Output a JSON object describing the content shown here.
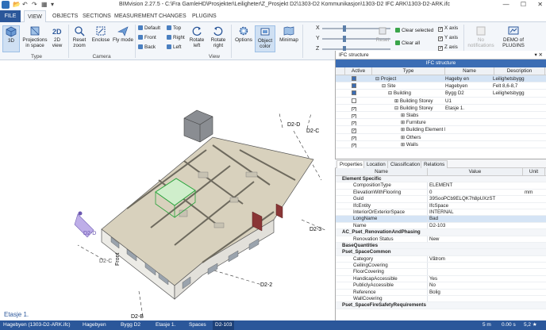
{
  "titlebar": {
    "title": "BIMvision 2.27.5 - C:\\Fra GamleHD\\Prosjekter\\Leiligheter\\Z_Prosjekt D2\\1303-D2 Kommunikasjon\\1303-D2 IFC ARK\\1303-D2-ARK.ifc",
    "minimize": "—",
    "maximize": "☐",
    "close": "✕"
  },
  "tabs": [
    "FILE",
    "VIEW",
    "OBJECTS",
    "SECTIONS",
    "MEASUREMENT",
    "CHANGES",
    "PLUGINS"
  ],
  "ribbon": {
    "type_group": "Type",
    "camera_group": "Camera",
    "view_group": "View",
    "btn_3d": "3D",
    "btn_projections": "Projections in space",
    "btn_2d": "2D view",
    "btn_reset_zoom": "Reset zoom",
    "btn_enclose": "Enclose",
    "btn_fly": "Fly mode",
    "views": [
      "Default",
      "Front",
      "Back",
      "Top",
      "Right",
      "Left"
    ],
    "btn_rotate_left": "Rotate left",
    "btn_rotate_right": "Rotate right",
    "btn_options": "Options",
    "btn_object_color": "Object color",
    "btn_minimap": "Minimap",
    "slider_x": "X",
    "slider_y": "Y",
    "slider_z": "Z",
    "btn_reset": "Reset",
    "btn_clear_selected": "Clear selected",
    "btn_clear_all": "Clear all",
    "cb_x_axis": "X axis",
    "cb_y_axis": "Y axis",
    "cb_z_axis": "Z axis",
    "btn_notifications": "No notifications",
    "btn_demo": "DEMO of PLUGINS"
  },
  "viewport": {
    "labels": [
      "D2-D",
      "D2-C",
      "D2-3",
      "D2-2",
      "D2-B",
      "D2-C",
      "Front",
      "D2-D"
    ],
    "storey_label": "Etasje 1."
  },
  "ifc": {
    "panel_title": "IFC structure",
    "sub_title": "IFC structure",
    "columns": [
      "Active",
      "Type",
      "Name",
      "Description"
    ],
    "rows": [
      {
        "type": "Project",
        "name": "Hageby en",
        "desc": "Leilighetsbygg"
      },
      {
        "type": "Site",
        "name": "Hagebyen",
        "desc": "Felt 8,6-8,7"
      },
      {
        "type": "Building",
        "name": "Bygg D2",
        "desc": "Leilighetsbygg"
      },
      {
        "type": "Building Storey",
        "name": "U1",
        "desc": ""
      },
      {
        "type": "Building Storey",
        "name": "Etasje 1.",
        "desc": ""
      },
      {
        "type": "Slabs",
        "name": "",
        "desc": ""
      },
      {
        "type": "Furniture",
        "name": "",
        "desc": ""
      },
      {
        "type": "Building Element Proxies",
        "name": "",
        "desc": ""
      },
      {
        "type": "Others",
        "name": "",
        "desc": ""
      },
      {
        "type": "Walls",
        "name": "",
        "desc": ""
      }
    ]
  },
  "prop_tabs": [
    "Properties",
    "Location",
    "Classification",
    "Relations"
  ],
  "props": {
    "columns": [
      "Name",
      "Value",
      "Unit"
    ],
    "rows": [
      {
        "g": true,
        "n": "Element Specific"
      },
      {
        "n": "CompositionType",
        "v": "ELEMENT"
      },
      {
        "n": "ElevationWithFlooring",
        "v": "0",
        "u": "mm"
      },
      {
        "n": "Guid",
        "v": "39SooPCb9ELQK7h8pUXzST"
      },
      {
        "n": "IfcEntity",
        "v": "IfcSpace"
      },
      {
        "n": "InteriorOrExteriorSpace",
        "v": "INTERNAL"
      },
      {
        "n": "LongName",
        "v": "Bad",
        "s": true
      },
      {
        "n": "Name",
        "v": "D2-103"
      },
      {
        "g": true,
        "n": "AC_Pset_RenovationAndPhasing"
      },
      {
        "n": "Renovation Status",
        "v": "New"
      },
      {
        "g": true,
        "n": "BaseQuantities"
      },
      {
        "g": true,
        "n": "Pset_SpaceCommon"
      },
      {
        "n": "Category",
        "v": "Våtrom"
      },
      {
        "n": "CeilingCovering",
        "v": ""
      },
      {
        "n": "FloorCovering",
        "v": ""
      },
      {
        "n": "HandicapAccessible",
        "v": "Yes"
      },
      {
        "n": "PubliclyAccessible",
        "v": "No"
      },
      {
        "n": "Reference",
        "v": "Bolig"
      },
      {
        "n": "WallCovering",
        "v": ""
      },
      {
        "g": true,
        "n": "Pset_SpaceFireSafetyRequirements"
      }
    ]
  },
  "statusbar": {
    "file": "Hagebyen (1303-D2-ARK.ifc)",
    "crumbs": [
      "Hagebyen",
      "Bygg D2",
      "Etasje 1.",
      "Spaces",
      "D2-103"
    ],
    "distance": "5 m",
    "time": "0.00 s",
    "fps": "5,2 ★"
  },
  "colors": {
    "accent": "#2b579a",
    "selection": "#d5e4f5"
  }
}
